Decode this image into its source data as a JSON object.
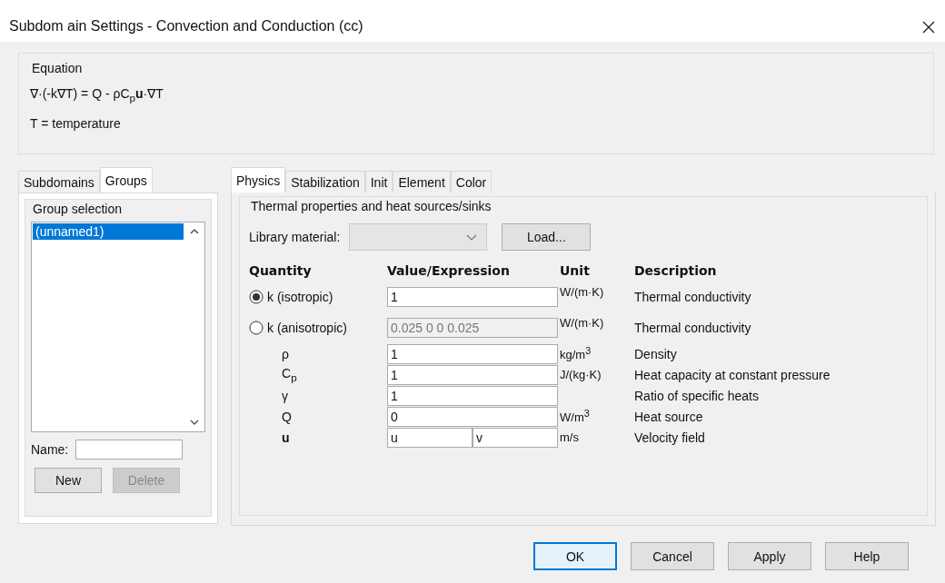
{
  "window": {
    "title": "Subdom ain Settings - Convection and Conduction (cc)"
  },
  "equation": {
    "legend": "Equation",
    "formula": "∇·(-k∇T) = Q - ρC$_{p}$**u**·∇T",
    "definition": "T = temperature"
  },
  "left_tabs": [
    {
      "label": "Subdomains",
      "selected": false
    },
    {
      "label": "Groups",
      "selected": true
    }
  ],
  "group_selection": {
    "legend": "Group selection",
    "items": [
      {
        "label": "(unnamed1)",
        "selected": true
      }
    ],
    "name_label": "Name:",
    "buttons": [
      {
        "label": "New",
        "disabled": false
      },
      {
        "label": "Delete",
        "disabled": true
      }
    ]
  },
  "right_tabs": [
    {
      "label": "Physics",
      "selected": true
    },
    {
      "label": "Stabilization",
      "selected": false
    },
    {
      "label": "Init",
      "selected": false
    },
    {
      "label": "Element",
      "selected": false
    },
    {
      "label": "Color",
      "selected": false
    }
  ],
  "physics": {
    "legend": "Thermal properties and heat sources/sinks",
    "library_label": "Library material:",
    "load_button": "Load...",
    "columns": [
      "Quantity",
      "Value/Expression",
      "Unit",
      "Description"
    ],
    "rows": [
      {
        "kind": "radio",
        "quantity": "k (isotropic)",
        "selected": true,
        "disabled": false,
        "values": [
          "1"
        ],
        "unit": "W/(m·K)",
        "description": "Thermal conductivity"
      },
      {
        "kind": "radio",
        "quantity": "k (anisotropic)",
        "selected": false,
        "disabled": true,
        "values": [
          "0.025 0 0 0.025"
        ],
        "unit": "W/(m·K)",
        "description": "Thermal conductivity"
      },
      {
        "kind": "plain",
        "quantity": "ρ",
        "disabled": false,
        "values": [
          "1"
        ],
        "unit": "kg/m$^{3}$",
        "description": "Density"
      },
      {
        "kind": "plain",
        "quantity": "C$_{p}$",
        "disabled": false,
        "values": [
          "1"
        ],
        "unit": "J/(kg·K)",
        "description": "Heat capacity at constant pressure"
      },
      {
        "kind": "plain",
        "quantity": "γ",
        "disabled": false,
        "values": [
          "1"
        ],
        "description": "Ratio of specific heats"
      },
      {
        "kind": "plain",
        "quantity": "Q",
        "disabled": false,
        "values": [
          "0"
        ],
        "unit": "W/m$^{3}$",
        "description": "Heat source"
      },
      {
        "kind": "plain",
        "quantity": "**u**",
        "disabled": false,
        "values": [
          "u",
          "v"
        ],
        "unit": "m/s",
        "description": "Velocity field"
      }
    ]
  },
  "buttons": [
    {
      "label": "OK",
      "default": true
    },
    {
      "label": "Cancel",
      "default": false
    },
    {
      "label": "Apply",
      "default": false
    },
    {
      "label": "Help",
      "default": false
    }
  ]
}
